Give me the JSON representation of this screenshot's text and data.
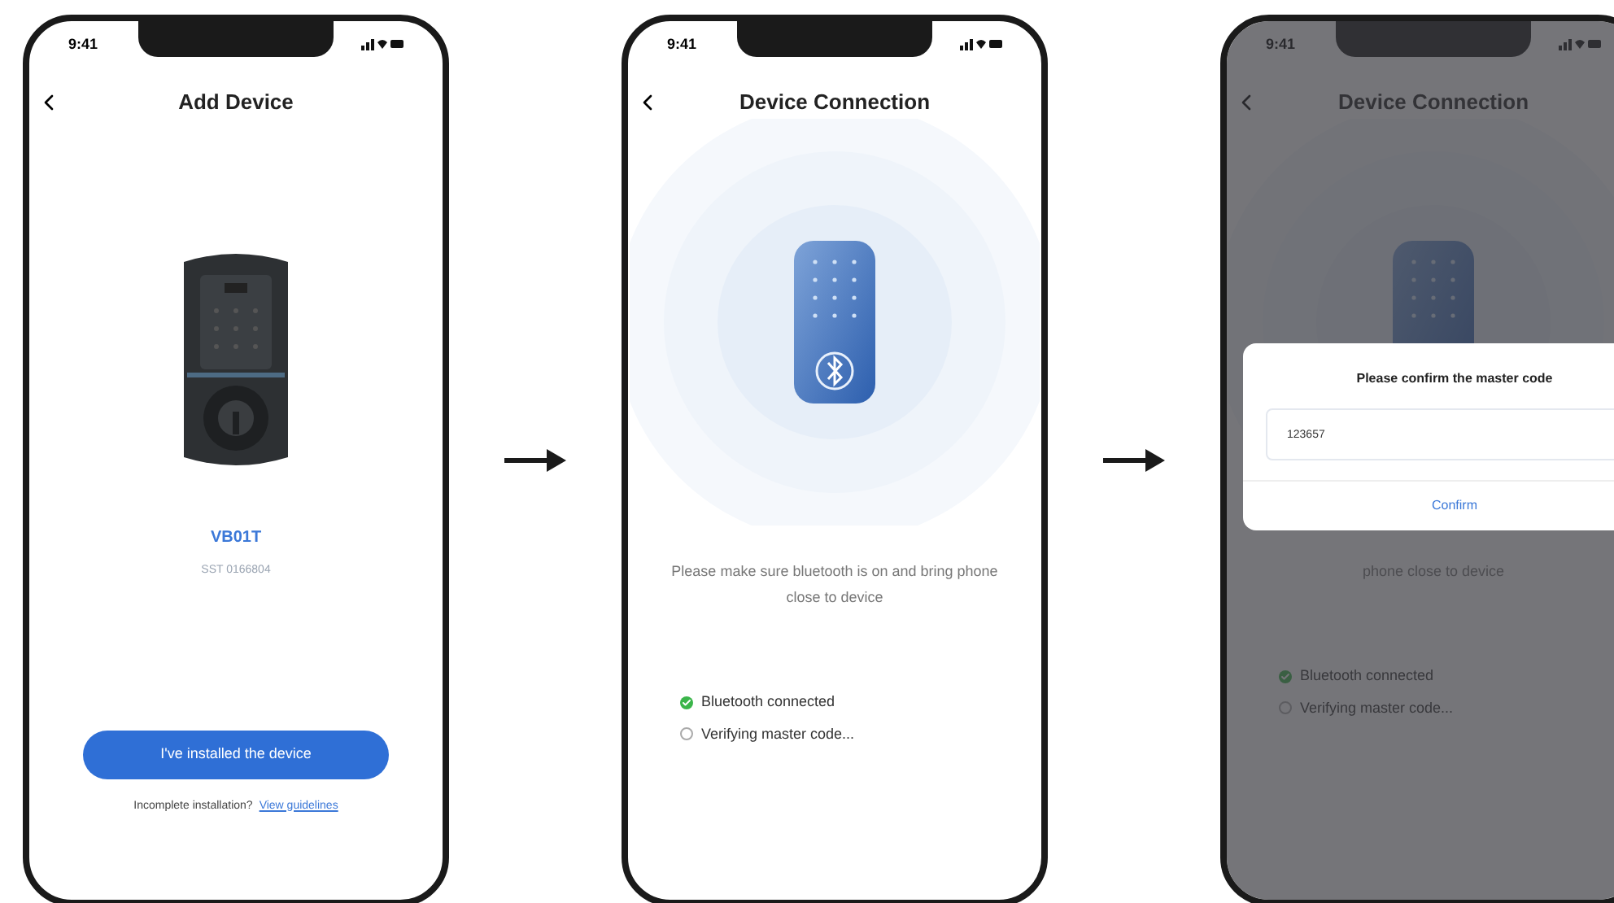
{
  "screens": [
    {
      "kind": "add_device",
      "time": "9:41",
      "title": "Add Device",
      "device_model": "VB01T",
      "device_serial": "SST 0166804",
      "primary_button": "I've installed the device",
      "help_text": "Incomplete installation?",
      "help_link": "View guidelines"
    },
    {
      "kind": "connection",
      "time": "9:41",
      "title": "Device Connection",
      "hint": "Please make sure bluetooth is on and bring phone close to device",
      "steps": [
        {
          "label": "Bluetooth connected",
          "checked": true
        },
        {
          "label": "Verifying master code...",
          "checked": false
        }
      ]
    },
    {
      "kind": "connection",
      "time": "9:41",
      "title": "Device Connection",
      "hint": "phone close to device",
      "steps": [
        {
          "label": "Bluetooth connected",
          "checked": true
        },
        {
          "label": "Verifying master code...",
          "checked": false
        }
      ],
      "dialog": {
        "title": "Please confirm the master code",
        "value": "123657",
        "button": "Confirm"
      }
    }
  ]
}
